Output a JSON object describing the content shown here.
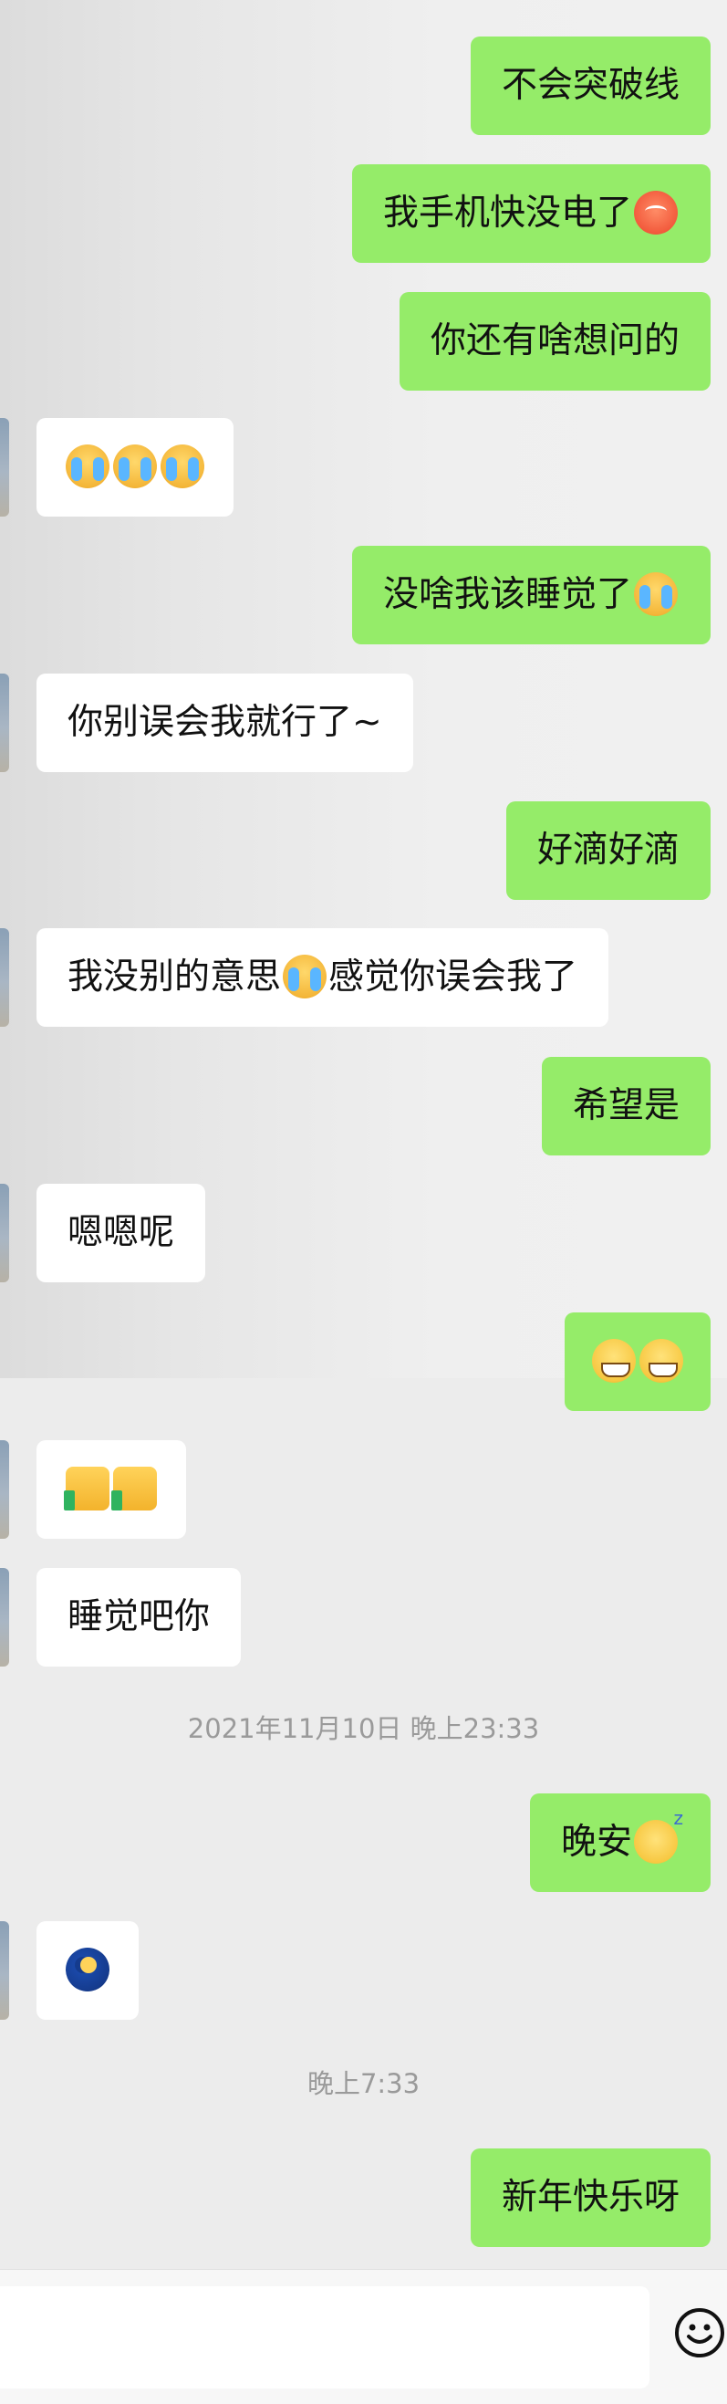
{
  "messages": [
    {
      "side": "me",
      "text": "不会突破线"
    },
    {
      "side": "me",
      "text": "我手机快没电了",
      "emoji": "dizzy"
    },
    {
      "side": "me",
      "text": "你还有啥想问的"
    },
    {
      "side": "them",
      "text": "",
      "emojis": [
        "cry",
        "cry",
        "cry"
      ]
    },
    {
      "side": "me",
      "text": "没啥我该睡觉了",
      "emoji": "cry"
    },
    {
      "side": "them",
      "text": "你别误会我就行了~"
    },
    {
      "side": "me",
      "text": "好滴好滴"
    },
    {
      "side": "them",
      "text_a": "我没别的意思",
      "emoji": "cry",
      "text_b": "感觉你误会我了"
    },
    {
      "side": "me",
      "text": "希望是"
    },
    {
      "side": "them",
      "text": "嗯嗯呢"
    },
    {
      "side": "me",
      "text": "",
      "emojis": [
        "grin",
        "grin"
      ]
    },
    {
      "side": "them",
      "text": "",
      "emojis": [
        "thumb",
        "thumb"
      ]
    },
    {
      "side": "them",
      "text": "睡觉吧你"
    },
    {
      "side": "me",
      "text": "晚安",
      "emoji": "sleep"
    },
    {
      "side": "them",
      "text": "",
      "emojis": [
        "moon"
      ]
    },
    {
      "side": "me",
      "text": "新年快乐呀"
    }
  ],
  "timestamps": {
    "t1": "2021年11月10日 晚上23:33",
    "t2": "晚上7:33"
  },
  "input": {
    "placeholder": ""
  },
  "colors": {
    "me_bubble": "#95ec69",
    "them_bubble": "#ffffff",
    "timestamp_text": "#9a9a9a",
    "background": "#ececec"
  },
  "icons": {
    "emoji_toggle": "smiley-face-icon"
  }
}
